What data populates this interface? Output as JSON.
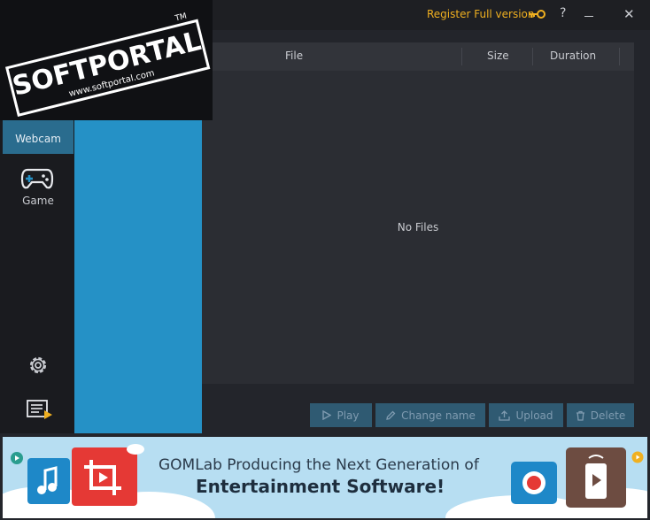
{
  "titlebar": {
    "register_label": "Register Full version",
    "help_label": "?",
    "close_label": "✕",
    "icons": [
      "key-icon",
      "minimize-icon"
    ]
  },
  "sidebar": {
    "items": [
      {
        "label": "Webcam",
        "icon": "webcam-icon",
        "active": true
      },
      {
        "label": "Game",
        "icon": "gamepad-icon",
        "active": false
      }
    ],
    "bottom_icons": [
      "gear-icon",
      "playlist-icon"
    ]
  },
  "file_table": {
    "columns": [
      "File",
      "Size",
      "Duration"
    ],
    "empty_text": "No Files"
  },
  "actions": {
    "play": "Play",
    "change_name": "Change name",
    "upload": "Upload",
    "delete": "Delete"
  },
  "banner": {
    "line1": "GOMLab Producing the Next Generation of",
    "line2": "Entertainment Software!"
  },
  "watermark": {
    "brand": "SOFTPORTAL",
    "tm": "TM",
    "url": "www.softportal.com"
  },
  "colors": {
    "accent_blue": "#2591c6",
    "register_orange": "#f0b020",
    "active_nav": "#2a6c8e"
  }
}
